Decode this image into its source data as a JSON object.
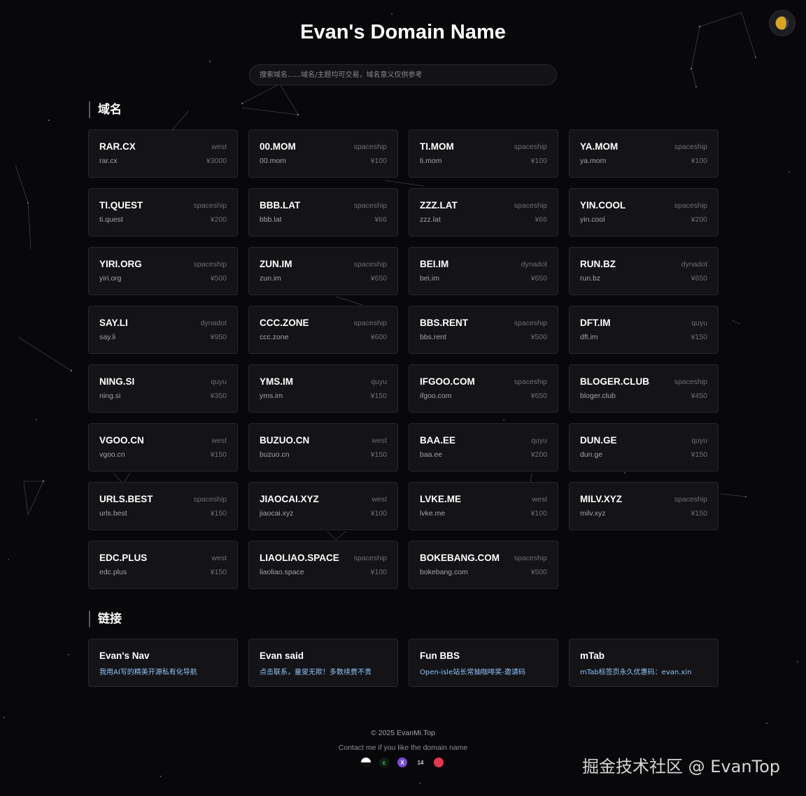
{
  "header": {
    "title": "Evan's Domain Name",
    "theme_toggle_icon": "moon-icon"
  },
  "search": {
    "placeholder": "搜索域名......域名/主题均可交易，域名意义仅供参考"
  },
  "domains_section": {
    "title": "域名",
    "items": [
      {
        "name": "RAR.CX",
        "url": "rar.cx",
        "registrar": "west",
        "price": "¥3000"
      },
      {
        "name": "00.MOM",
        "url": "00.mom",
        "registrar": "spaceship",
        "price": "¥100"
      },
      {
        "name": "TI.MOM",
        "url": "ti.mom",
        "registrar": "spaceship",
        "price": "¥100"
      },
      {
        "name": "YA.MOM",
        "url": "ya.mom",
        "registrar": "spaceship",
        "price": "¥100"
      },
      {
        "name": "TI.QUEST",
        "url": "ti.quest",
        "registrar": "spaceship",
        "price": "¥200"
      },
      {
        "name": "BBB.LAT",
        "url": "bbb.lat",
        "registrar": "spaceship",
        "price": "¥66"
      },
      {
        "name": "ZZZ.LAT",
        "url": "zzz.lat",
        "registrar": "spaceship",
        "price": "¥66"
      },
      {
        "name": "YIN.COOL",
        "url": "yin.cool",
        "registrar": "spaceship",
        "price": "¥200"
      },
      {
        "name": "YIRI.ORG",
        "url": "yiri.org",
        "registrar": "spaceship",
        "price": "¥500"
      },
      {
        "name": "ZUN.IM",
        "url": "zun.im",
        "registrar": "spaceship",
        "price": "¥650"
      },
      {
        "name": "BEI.IM",
        "url": "bei.im",
        "registrar": "dynadot",
        "price": "¥650"
      },
      {
        "name": "RUN.BZ",
        "url": "run.bz",
        "registrar": "dynadot",
        "price": "¥650"
      },
      {
        "name": "SAY.LI",
        "url": "say.li",
        "registrar": "dynadot",
        "price": "¥950"
      },
      {
        "name": "CCC.ZONE",
        "url": "ccc.zone",
        "registrar": "spaceship",
        "price": "¥600"
      },
      {
        "name": "BBS.RENT",
        "url": "bbs.rent",
        "registrar": "spaceship",
        "price": "¥500"
      },
      {
        "name": "DFT.IM",
        "url": "dft.im",
        "registrar": "quyu",
        "price": "¥150"
      },
      {
        "name": "NING.SI",
        "url": "ning.si",
        "registrar": "quyu",
        "price": "¥350"
      },
      {
        "name": "YMS.IM",
        "url": "yms.im",
        "registrar": "quyu",
        "price": "¥150"
      },
      {
        "name": "IFGOO.COM",
        "url": "ifgoo.com",
        "registrar": "spaceship",
        "price": "¥650"
      },
      {
        "name": "BLOGER.CLUB",
        "url": "bloger.club",
        "registrar": "spaceship",
        "price": "¥450"
      },
      {
        "name": "VGOO.CN",
        "url": "vgoo.cn",
        "registrar": "west",
        "price": "¥150"
      },
      {
        "name": "BUZUO.CN",
        "url": "buzuo.cn",
        "registrar": "west",
        "price": "¥150"
      },
      {
        "name": "BAA.EE",
        "url": "baa.ee",
        "registrar": "quyu",
        "price": "¥200"
      },
      {
        "name": "DUN.GE",
        "url": "dun.ge",
        "registrar": "quyu",
        "price": "¥150"
      },
      {
        "name": "URLS.BEST",
        "url": "urls.best",
        "registrar": "spaceship",
        "price": "¥150"
      },
      {
        "name": "JIAOCAI.XYZ",
        "url": "jiaocai.xyz",
        "registrar": "west",
        "price": "¥100"
      },
      {
        "name": "LVKE.ME",
        "url": "lvke.me",
        "registrar": "west",
        "price": "¥100"
      },
      {
        "name": "MILV.XYZ",
        "url": "milv.xyz",
        "registrar": "spaceship",
        "price": "¥150"
      },
      {
        "name": "EDC.PLUS",
        "url": "edc.plus",
        "registrar": "west",
        "price": "¥150"
      },
      {
        "name": "LIAOLIAO.SPACE",
        "url": "liaoliao.space",
        "registrar": "spaceship",
        "price": "¥100"
      },
      {
        "name": "BOKEBANG.COM",
        "url": "bokebang.com",
        "registrar": "spaceship",
        "price": "¥500"
      }
    ]
  },
  "links_section": {
    "title": "链接",
    "items": [
      {
        "name": "Evan's Nav",
        "desc": "我用AI写的精美开源私有化导航"
      },
      {
        "name": "Evan said",
        "desc": "点击联系，童叟无欺！多数续费不贵"
      },
      {
        "name": "Fun BBS",
        "desc": "Open-isle站长常抽咖啡奖-邀请码"
      },
      {
        "name": "mTab",
        "desc": "mTab标签页永久优惠码：evan.xin"
      }
    ]
  },
  "footer": {
    "copyright": "© 2025 EvanMi.Top",
    "contact": "Contact me if you like the domain name",
    "social_icons": [
      {
        "icon": "github-icon",
        "glyph": ""
      },
      {
        "icon": "green-c-icon",
        "glyph": "c"
      },
      {
        "icon": "purple-x-icon",
        "glyph": "X"
      },
      {
        "icon": "number-14-icon",
        "glyph": "14"
      },
      {
        "icon": "red-logo-icon",
        "glyph": ""
      }
    ]
  },
  "watermark": "掘金技术社区 @ EvanTop",
  "colors": {
    "background": "#08080a",
    "card": "#141417",
    "card_border": "#27272c",
    "link_desc": "#8fc3f5"
  }
}
